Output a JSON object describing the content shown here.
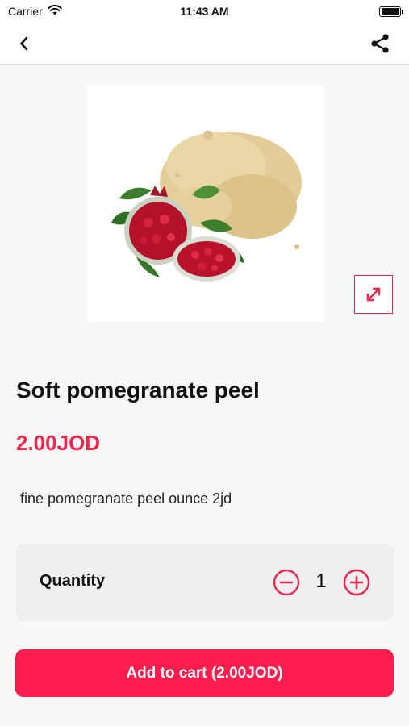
{
  "status_bar": {
    "carrier": "Carrier",
    "time": "11:43 AM",
    "icons": [
      "wifi-icon",
      "battery-icon"
    ]
  },
  "nav": {
    "back_icon": "chevron-left-icon",
    "share_icon": "share-icon"
  },
  "product": {
    "image_alt": "pomegranate peel powder",
    "expand_icon": "expand-icon",
    "title": "Soft pomegranate peel",
    "price": "2.00JOD",
    "description": "fine pomegranate peel ounce 2jd"
  },
  "quantity": {
    "label": "Quantity",
    "value": "1",
    "minus_icon": "minus-circle-icon",
    "plus_icon": "plus-circle-icon"
  },
  "cart": {
    "button_label": "Add to cart (2.00JOD)"
  },
  "colors": {
    "accent": "#f0264d",
    "button": "#ff1d4e",
    "background": "#f8f8f9",
    "card": "#efeff1"
  }
}
